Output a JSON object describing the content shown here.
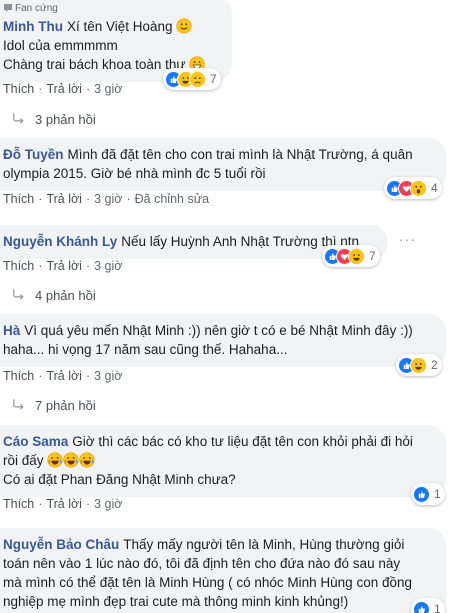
{
  "labels": {
    "like": "Thích",
    "reply": "Trả lời",
    "edited": "Đã chỉnh sửa",
    "fan_badge": "Fan cứng"
  },
  "comments": [
    {
      "author": "Minh Thu",
      "lines": [
        "Xí tên Việt Hoàng",
        "Idol của emmmmm",
        "Chàng trai bách khoa toàn thư"
      ],
      "time": "3 giờ",
      "reaction_count": "7",
      "replies": "3 phản hồi"
    },
    {
      "author": "Đỗ Tuyền",
      "lines": [
        "Mình đã đặt tên cho con trai mình là Nhật Trường, á quân",
        "olympia 2015. Giờ bé nhà mình đc 5 tuổi rồi"
      ],
      "time": "3 giờ",
      "reaction_count": "4"
    },
    {
      "author": "Nguyễn Khánh Ly",
      "lines": [
        "Nếu lấy Huỳnh Anh Nhật Trường thì ntn"
      ],
      "time": "3 giờ",
      "reaction_count": "7",
      "replies": "4 phản hồi"
    },
    {
      "author": "Hà",
      "lines": [
        "Vì quá yêu mến Nhật Minh :)) nên giờ t có e bé Nhật Minh đây :))",
        "haha... hi vọng 17 năm sau cũng thế. Hahaha..."
      ],
      "time": "3 giờ",
      "reaction_count": "2",
      "replies": "7 phản hồi"
    },
    {
      "author": "Cáo Sama",
      "lines": [
        "Giờ thì các bác có kho tư liệu đặt tên con khỏi phải đi hỏi",
        "rồi đấy",
        "Có ai đặt Phan Đăng Nhật Minh chưa?"
      ],
      "time": "3 giờ",
      "reaction_count": "1"
    },
    {
      "author": "Nguyễn Bảo Châu",
      "lines": [
        "Thấy mấy người tên là Minh, Hùng thường giỏi",
        "toán nên vào 1 lúc nào đó, tôi đã định tên cho đứa nào đó sau này",
        "mà mình có thể đặt tên là Minh Hùng ( có nhóc Minh Hùng con đồng",
        "nghiệp mẹ mình đẹp trai cute mà thông minh kinh khủng!)"
      ],
      "reaction_count": "1"
    }
  ],
  "icons": {
    "smile": "slightly-smiling-emoji",
    "grin": "grinning-emoji",
    "laugh": "tears-of-joy-emoji"
  },
  "colors": {
    "author": "#385898",
    "bubble": "#f2f3f5",
    "like": "#1877f2",
    "love": "#f33e58",
    "emoji": "#fcc419"
  }
}
